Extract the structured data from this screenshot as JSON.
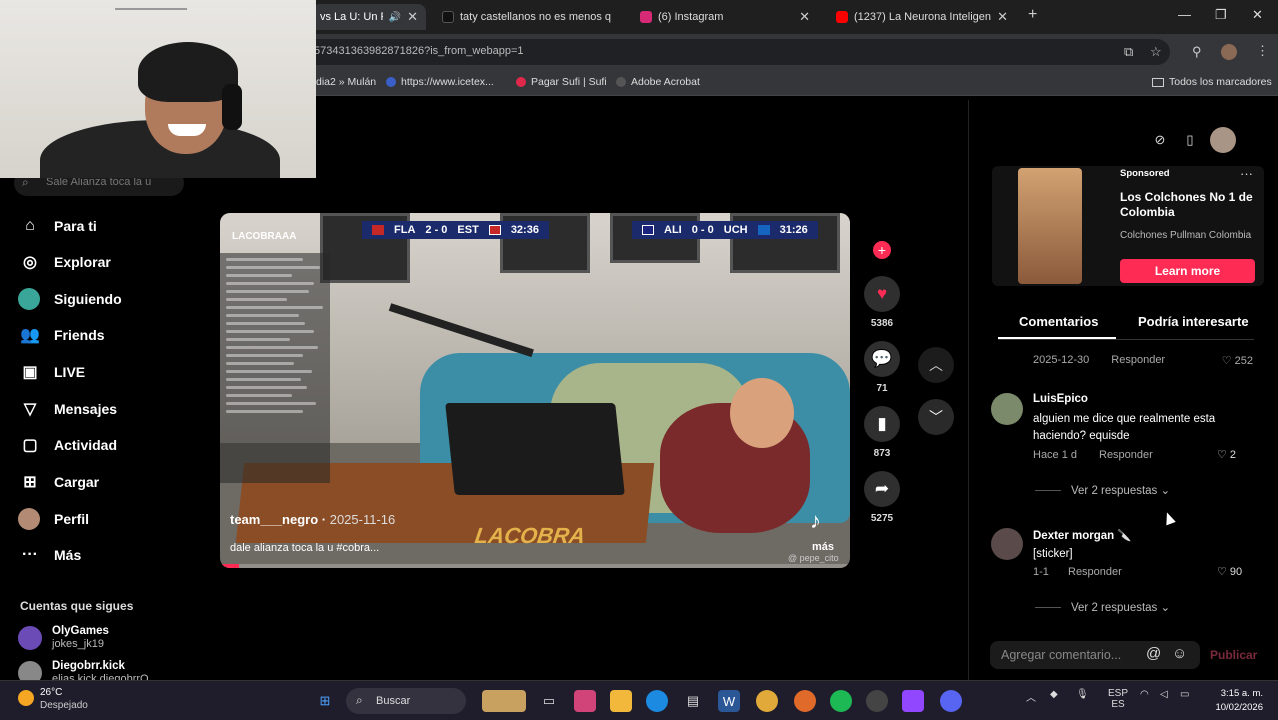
{
  "browser": {
    "tabs": [
      {
        "title": "vs La U: Un Pa",
        "active": true,
        "color": "#333"
      },
      {
        "title": "taty castellanos no es menos q",
        "active": false,
        "color": "#111"
      },
      {
        "title": "(6) Instagram",
        "active": false,
        "color": "#d62976"
      },
      {
        "title": "(1237) La Neurona Inteligente -",
        "active": false,
        "color": "#ff0000"
      }
    ],
    "url": "57343136398287182​6?is_from_webapp=1",
    "bookmarks": [
      "dia2 » Mulán",
      "https://www.icetex...",
      "Pagar Sufi | Sufi",
      "Adobe Acrobat"
    ],
    "all_bookmarks": "Todos los marcadores"
  },
  "sidebar": {
    "search_placeholder": "Sale Alianza toca la u",
    "items": [
      {
        "label": "Para ti",
        "icon": "home-icon"
      },
      {
        "label": "Explorar",
        "icon": "compass-icon"
      },
      {
        "label": "Siguiendo",
        "icon": "following-avatar"
      },
      {
        "label": "Friends",
        "icon": "friends-icon"
      },
      {
        "label": "LIVE",
        "icon": "live-icon"
      },
      {
        "label": "Mensajes",
        "icon": "messages-icon"
      },
      {
        "label": "Actividad",
        "icon": "activity-icon"
      },
      {
        "label": "Cargar",
        "icon": "upload-icon"
      },
      {
        "label": "Perfil",
        "icon": "profile-avatar"
      },
      {
        "label": "Más",
        "icon": "more-icon"
      }
    ],
    "following_heading": "Cuentas que sigues",
    "following": [
      {
        "name": "OlyGames",
        "sub": "jokes_jk19"
      },
      {
        "name": "Diegobrr.kick",
        "sub": "elias.kick.diegobrrO"
      }
    ]
  },
  "video": {
    "score1": {
      "home": "FLA",
      "score": "2 - 0",
      "away": "EST",
      "time": "32:36"
    },
    "score2": {
      "home": "ALI",
      "score": "0 - 0",
      "away": "UCH",
      "time": "31:26"
    },
    "channel": "LACOBRAAA",
    "brand": "LACOBRA",
    "author": "team___negro",
    "date": "2025-11-16",
    "description": "dale alianza toca la u #cobra...",
    "more": "más",
    "watermark": "@ pepe_cito",
    "progress": 0.03
  },
  "actions": {
    "likes": "5386",
    "comments": "71",
    "saves": "873",
    "shares": "5275"
  },
  "ad": {
    "sponsored": "Sponsored",
    "title": "Los Colchones No 1 de Colombia",
    "advertiser": "Colchones Pullman Colombia",
    "cta": "Learn more"
  },
  "tabs": {
    "comments": "Comentarios",
    "related": "Podría interesarte"
  },
  "comments": {
    "partial": {
      "date": "2025-12-30",
      "reply": "Responder",
      "likes": "252"
    },
    "items": [
      {
        "user": "LuisEpico",
        "text": "alguien me dice que realmente esta haciendo? equisde",
        "date": "Hace 1 d",
        "reply": "Responder",
        "likes": "2",
        "more": "Ver 2 respuestas"
      },
      {
        "user": "Dexter morgan 🔪",
        "text": "[sticker]",
        "date": "1-1",
        "reply": "Responder",
        "likes": "90",
        "more": "Ver 2 respuestas"
      }
    ],
    "input_placeholder": "Agregar comentario...",
    "post": "Publicar"
  },
  "taskbar": {
    "temp": "26°C",
    "weather": "Despejado",
    "search": "Buscar",
    "lang1": "ESP",
    "lang2": "ES",
    "time": "3:15 a. m.",
    "date": "10/02/2026"
  },
  "colors": {
    "accent": "#fe2c55",
    "taskbar": "#1f1d2b"
  }
}
